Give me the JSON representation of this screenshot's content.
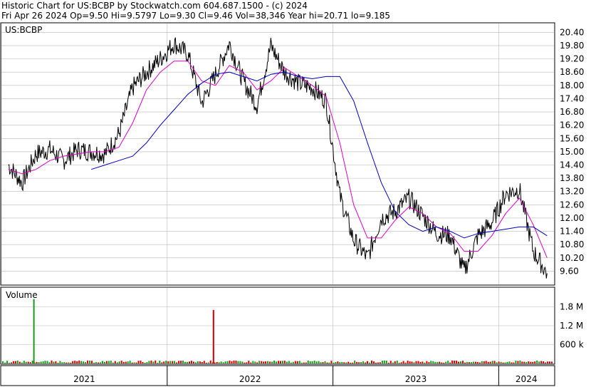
{
  "header": {
    "title": "Historic Chart for US:BCBP by Stockwatch.com 604.687.1500 - (c) 2024",
    "quote": "Fri Apr 26 2024   Op=9.50   Hi=9.5797   Lo=9.30   Cl=9.46   Vol=38,346   Year hi=20.71   lo=9.185"
  },
  "colors": {
    "price": "#000000",
    "ma_short": "#e000c8",
    "ma_long": "#0000c8",
    "volume_up": "#1a9a1a",
    "volume_down": "#d00000",
    "grid": "#b8b8b8"
  },
  "chart_data": [
    {
      "type": "line",
      "panel": "price",
      "symbol_label": "US:BCBP",
      "ylim": [
        9.0,
        20.8
      ],
      "y_ticks": [
        "20.40",
        "19.80",
        "19.20",
        "18.60",
        "18.00",
        "17.40",
        "16.80",
        "16.20",
        "15.60",
        "15.00",
        "14.40",
        "13.80",
        "13.20",
        "12.60",
        "12.00",
        "11.40",
        "10.80",
        "10.20",
        "9.60"
      ],
      "x_ticks": [
        "2021",
        "2022",
        "2023",
        "2024"
      ],
      "x": [
        "2021-01",
        "2021-02",
        "2021-03",
        "2021-04",
        "2021-05",
        "2021-06",
        "2021-07",
        "2021-08",
        "2021-09",
        "2021-10",
        "2021-11",
        "2021-12",
        "2022-01",
        "2022-02",
        "2022-03",
        "2022-04",
        "2022-05",
        "2022-06",
        "2022-07",
        "2022-08",
        "2022-09",
        "2022-10",
        "2022-11",
        "2022-12",
        "2023-01",
        "2023-02",
        "2023-03",
        "2023-04",
        "2023-05",
        "2023-06",
        "2023-07",
        "2023-08",
        "2023-09",
        "2023-10",
        "2023-11",
        "2023-12",
        "2024-01",
        "2024-02",
        "2024-03",
        "2024-04"
      ],
      "series": [
        {
          "values": [
            14.4,
            13.6,
            14.9,
            15.1,
            14.6,
            15.1,
            15.0,
            14.9,
            15.8,
            17.9,
            18.6,
            19.2,
            19.9,
            19.4,
            17.2,
            18.5,
            19.9,
            18.2,
            17.1,
            19.8,
            18.6,
            18.1,
            17.9,
            17.3,
            13.0,
            11.0,
            10.2,
            12.0,
            12.3,
            12.9,
            12.1,
            11.3,
            11.2,
            9.6,
            11.2,
            11.8,
            13.1,
            13.3,
            10.5,
            9.5
          ]
        },
        {
          "values": [
            14.2,
            14.0,
            14.2,
            14.6,
            14.8,
            14.9,
            15.0,
            15.0,
            15.2,
            16.3,
            17.8,
            18.6,
            19.1,
            19.1,
            18.2,
            18.0,
            18.9,
            18.6,
            17.8,
            18.2,
            18.8,
            18.4,
            18.0,
            17.5,
            15.4,
            12.6,
            11.1,
            11.1,
            11.9,
            12.5,
            12.2,
            11.6,
            11.3,
            10.5,
            10.5,
            11.2,
            12.2,
            12.9,
            11.7,
            10.2
          ]
        },
        {
          "values": [
            null,
            null,
            null,
            null,
            null,
            null,
            14.2,
            14.4,
            14.6,
            14.8,
            15.4,
            16.2,
            16.9,
            17.6,
            18.1,
            18.5,
            18.6,
            18.4,
            18.2,
            18.5,
            18.6,
            18.4,
            18.3,
            18.4,
            18.4,
            17.3,
            15.4,
            13.6,
            12.3,
            11.7,
            11.4,
            11.6,
            11.4,
            11.1,
            11.3,
            11.4,
            11.5,
            11.6,
            11.6,
            11.2
          ]
        }
      ]
    },
    {
      "type": "bar",
      "panel": "volume",
      "title": "Volume",
      "y_ticks": [
        "1.8 M",
        "1.2 M",
        "600 k"
      ],
      "ylim": [
        0,
        2400000
      ],
      "spikes": [
        {
          "date": "2021-03",
          "value": 2050000,
          "direction": "up"
        },
        {
          "date": "2022-04",
          "value": 1700000,
          "direction": "down"
        }
      ],
      "typical_volume": 60000
    }
  ]
}
